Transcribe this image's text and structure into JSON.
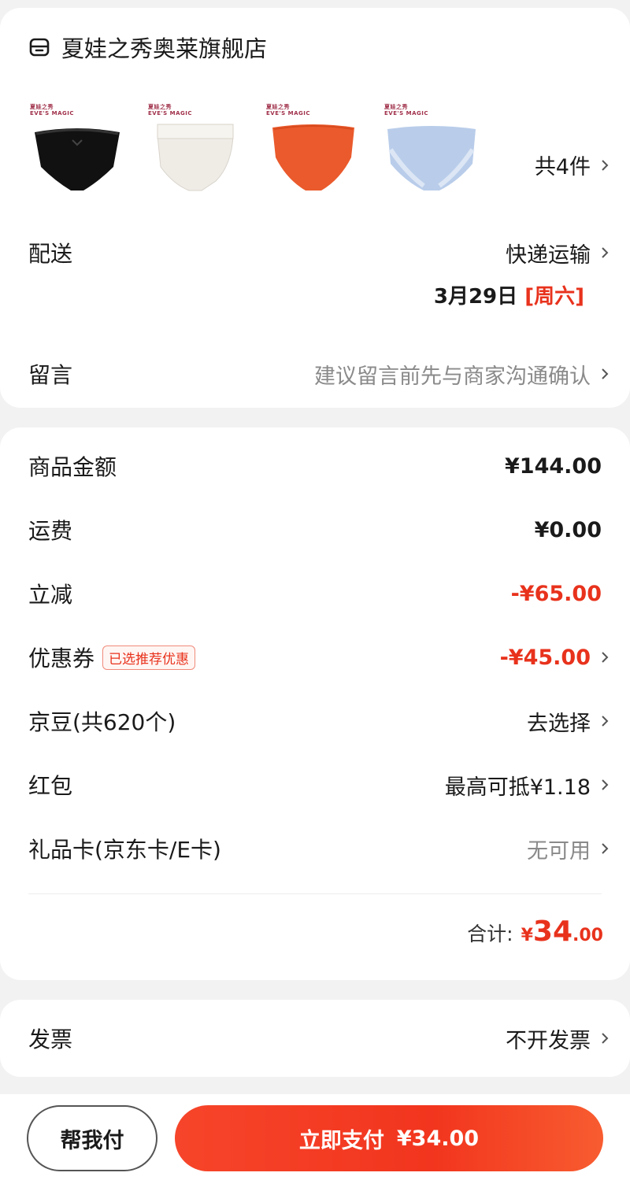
{
  "store": {
    "name": "夏娃之秀奥莱旗舰店",
    "icon": "store-icon",
    "item_count_label": "共4件",
    "products": [
      {
        "brand": "夏娃之秀",
        "brand_en": "EVE'S MAGIC",
        "color": "#111111"
      },
      {
        "brand": "夏娃之秀",
        "brand_en": "EVE'S MAGIC",
        "color": "#efece6"
      },
      {
        "brand": "夏娃之秀",
        "brand_en": "EVE'S MAGIC",
        "color": "#ea5a2c"
      },
      {
        "brand": "夏娃之秀",
        "brand_en": "EVE'S MAGIC",
        "color": "#b9cdea"
      }
    ]
  },
  "delivery": {
    "label": "配送",
    "method": "快递运输",
    "date": "3月29日",
    "weekday": "[周六]"
  },
  "message": {
    "label": "留言",
    "placeholder": "建议留言前先与商家沟通确认"
  },
  "price": {
    "goods": {
      "label": "商品金额",
      "value": "¥144.00"
    },
    "shipping": {
      "label": "运费",
      "value": "¥0.00"
    },
    "discount": {
      "label": "立减",
      "value": "-¥65.00"
    },
    "coupon": {
      "label": "优惠券",
      "tag": "已选推荐优惠",
      "value": "-¥45.00"
    },
    "jingdou": {
      "label": "京豆(共620个)",
      "value": "去选择"
    },
    "redpacket": {
      "label": "红包",
      "value": "最高可抵¥1.18"
    },
    "giftcard": {
      "label": "礼品卡(京东卡/E卡)",
      "value": "无可用"
    },
    "total": {
      "label": "合计:",
      "currency": "¥",
      "integer": "34",
      "decimal": ".00"
    }
  },
  "invoice": {
    "label": "发票",
    "value": "不开发票"
  },
  "actions": {
    "help_pay": "帮我付",
    "pay_now": "立即支付",
    "pay_amount": "¥34.00"
  },
  "colors": {
    "accent": "#e8321c",
    "background": "#f2f2f2"
  }
}
